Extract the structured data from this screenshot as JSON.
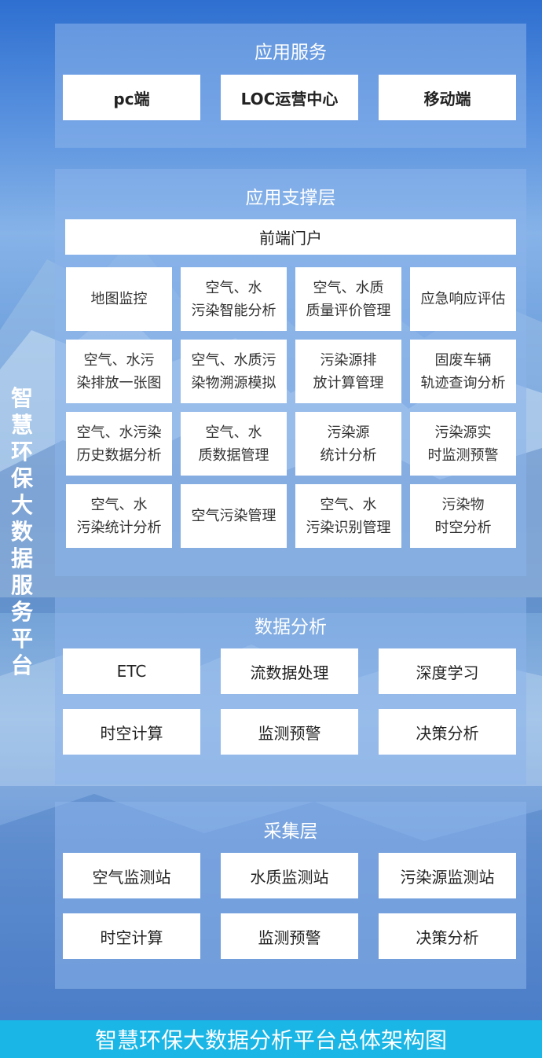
{
  "side_title": [
    "智",
    "慧",
    "环",
    "保",
    "大",
    "数",
    "据",
    "服",
    "务",
    "平",
    "台"
  ],
  "app_service": {
    "title": "应用服务",
    "items": [
      "pc端",
      "LOC运营中心",
      "移动端"
    ]
  },
  "support": {
    "title": "应用支撑层",
    "portal": "前端门户",
    "grid": [
      "地图监控",
      "空气、水\n污染智能分析",
      "空气、水质\n质量评价管理",
      "应急响应评估",
      "空气、水污\n染排放一张图",
      "空气、水质污\n染物溯源模拟",
      "污染源排\n放计算管理",
      "固废车辆\n轨迹查询分析",
      "空气、水污染\n历史数据分析",
      "空气、水\n质数据管理",
      "污染源\n统计分析",
      "污染源实\n时监测预警",
      "空气、水\n污染统计分析",
      "空气污染管理",
      "空气、水\n污染识别管理",
      "污染物\n时空分析"
    ]
  },
  "analysis": {
    "title": "数据分析",
    "items": [
      "ETC",
      "流数据处理",
      "深度学习",
      "时空计算",
      "监测预警",
      "决策分析"
    ]
  },
  "collect": {
    "title": "采集层",
    "items": [
      "空气监测站",
      "水质监测站",
      "污染源监测站",
      "时空计算",
      "监测预警",
      "决策分析"
    ]
  },
  "footer": "智慧环保大数据分析平台总体架构图",
  "colors": {
    "panel": "#8cb4eb",
    "footer": "#19b6e6",
    "box": "#ffffff"
  }
}
